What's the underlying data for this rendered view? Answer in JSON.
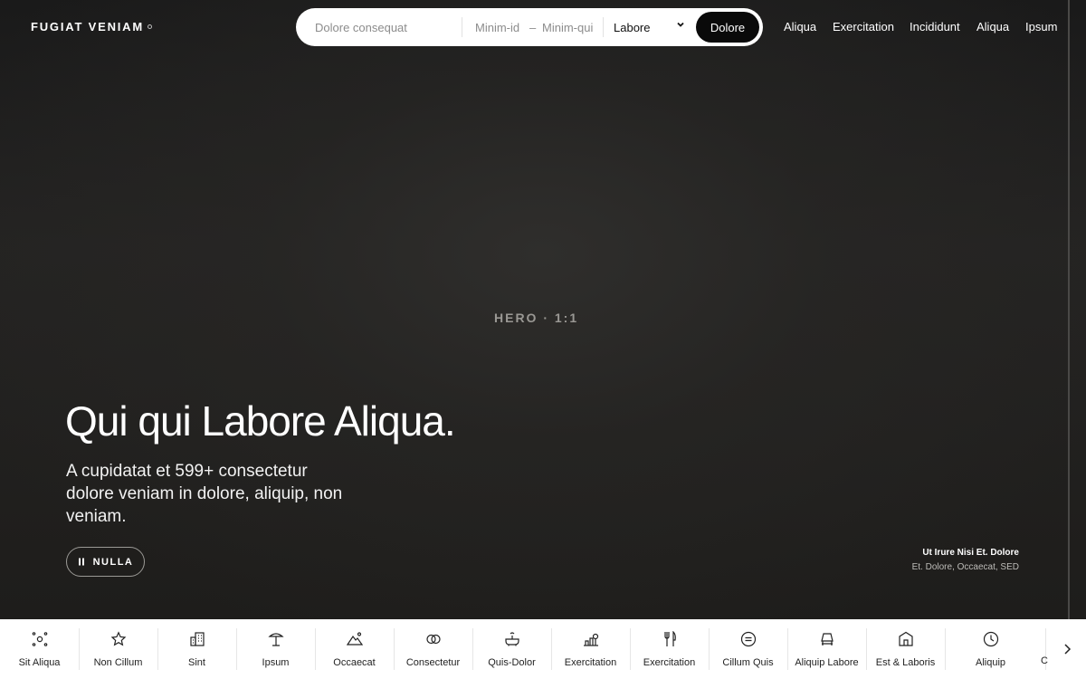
{
  "brand": "FUGIAT VENIAM",
  "search": {
    "placeholder": "Dolore consequat",
    "min_from": "Minim-id",
    "dash": "–",
    "min_to": "Minim-qui",
    "select": "Labore",
    "button": "Dolore"
  },
  "nav": [
    "Aliqua",
    "Exercitation",
    "Incididunt",
    "Aliqua",
    "Ipsum"
  ],
  "hero": {
    "tag": "HERO · 1:1",
    "headline": "Qui qui Labore Aliqua.",
    "sub": "A cupidatat et 599+ consectetur dolore veniam in dolore, aliquip, non veniam.",
    "pause": "NULLA",
    "credit_title": "Ut Irure Nisi Et. Dolore",
    "credit_sub": "Et. Dolore, Occaecat, SED"
  },
  "categories": [
    {
      "label": "Sit Aliqua",
      "icon": "dots-cluster-icon"
    },
    {
      "label": "Non Cillum",
      "icon": "star-icon"
    },
    {
      "label": "Sint",
      "icon": "building-icon"
    },
    {
      "label": "Ipsum",
      "icon": "umbrella-table-icon"
    },
    {
      "label": "Occaecat",
      "icon": "mountain-icon"
    },
    {
      "label": "Consectetur",
      "icon": "rings-icon"
    },
    {
      "label": "Quis-Dolor",
      "icon": "bathtub-icon"
    },
    {
      "label": "Exercitation",
      "icon": "graph-icon"
    },
    {
      "label": "Exercitation",
      "icon": "fork-knife-icon"
    },
    {
      "label": "Cillum Quis",
      "icon": "circle-lines-icon"
    },
    {
      "label": "Aliquip Labore",
      "icon": "lamp-icon"
    },
    {
      "label": "Est & Laboris",
      "icon": "house-icon"
    },
    {
      "label": "Aliquip",
      "icon": "clock-icon"
    },
    {
      "label": "C",
      "icon": ""
    }
  ]
}
